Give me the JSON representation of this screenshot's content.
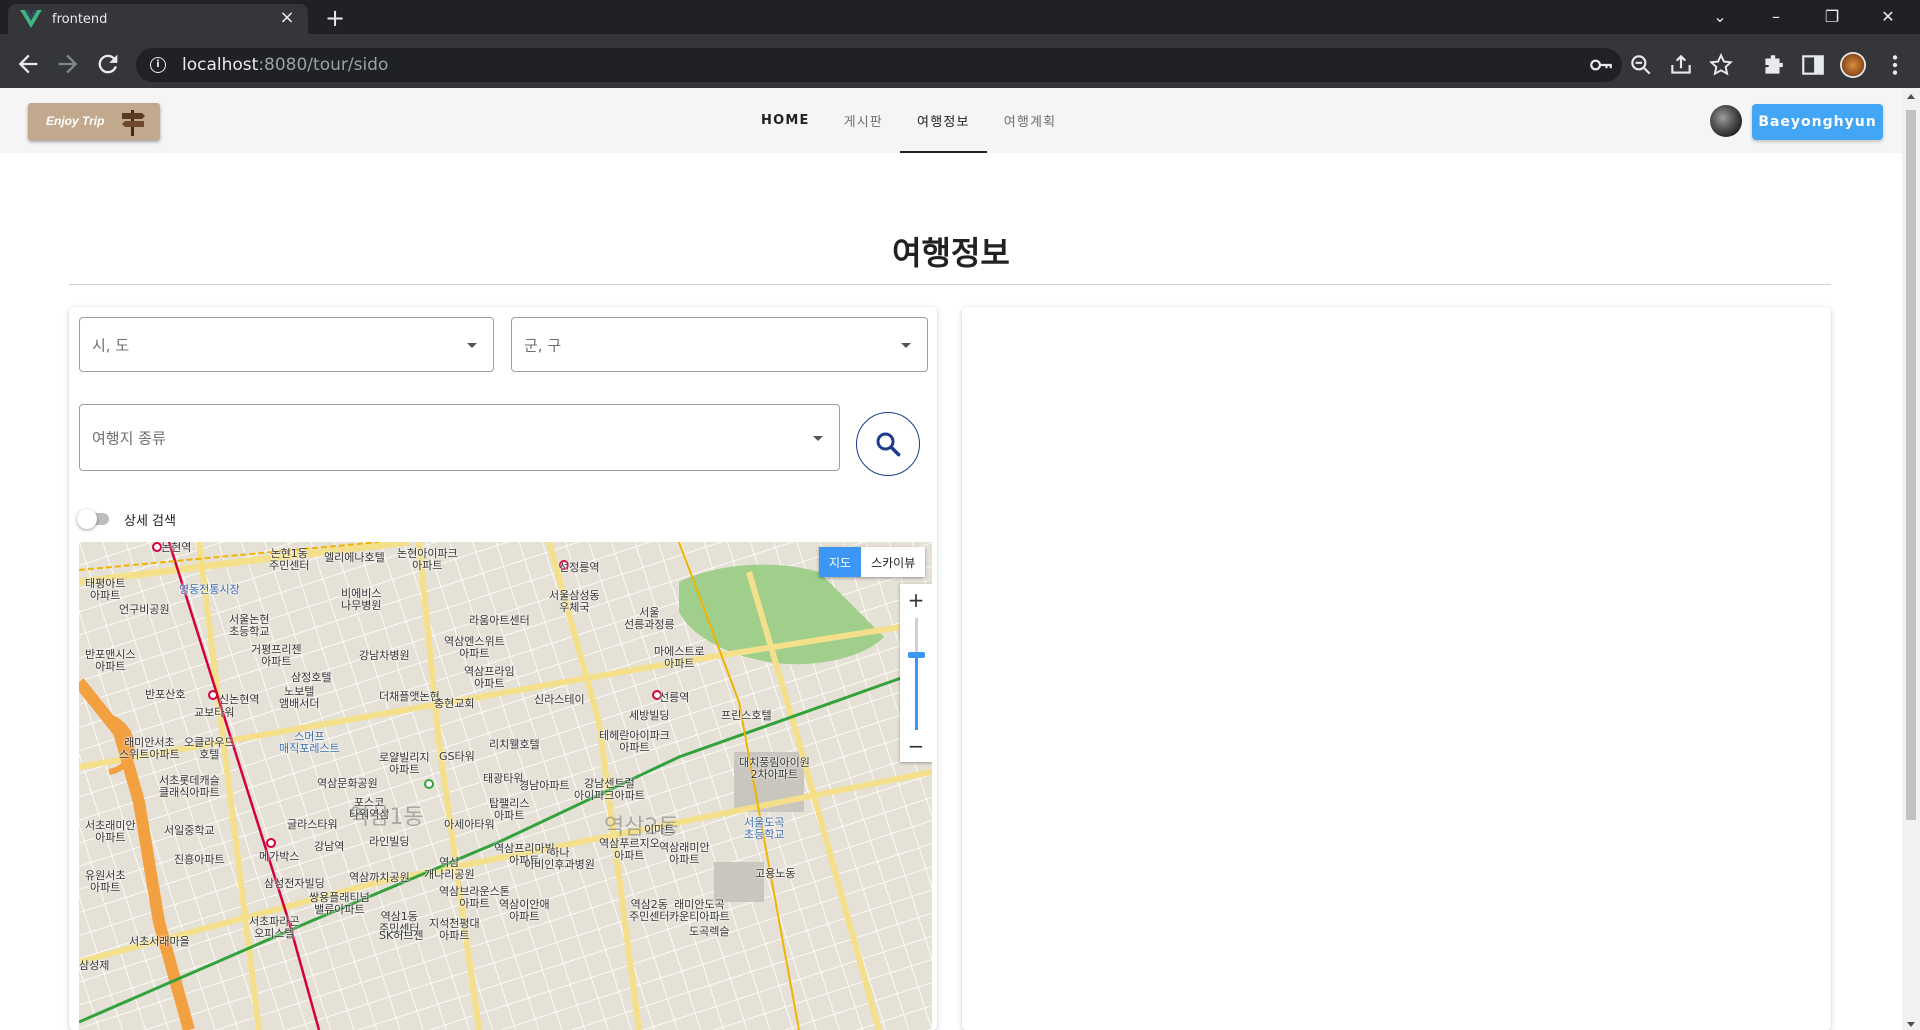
{
  "browser": {
    "tab_title": "frontend",
    "url_host": "localhost",
    "url_path": ":8080/tour/sido"
  },
  "header": {
    "logo_text": "Enjoy Trip",
    "nav": [
      "HOME",
      "게시판",
      "여행정보",
      "여행계획"
    ],
    "active_nav": "여행정보",
    "user_button": "Baeyonghyun"
  },
  "page": {
    "title": "여행정보"
  },
  "filters": {
    "sido_placeholder": "시, 도",
    "gugun_placeholder": "군, 구",
    "type_placeholder": "여행지 종류",
    "detail_toggle_label": "상세 검색",
    "detail_toggle_on": false
  },
  "map": {
    "type_buttons": [
      "지도",
      "스카이뷰"
    ],
    "selected_type": "지도",
    "zoom_in": "+",
    "zoom_out": "−",
    "labels": [
      {
        "text": "논현역",
        "cls": ""
      },
      {
        "text": "논현1동\n주민센터",
        "cls": ""
      },
      {
        "text": "엘리에나호텔",
        "cls": ""
      },
      {
        "text": "논현아이파크\n아파트",
        "cls": ""
      },
      {
        "text": "선정릉역",
        "cls": ""
      },
      {
        "text": "태평아트\n아파트",
        "cls": ""
      },
      {
        "text": "영동전통시장",
        "cls": "blue"
      },
      {
        "text": "비에비스\n나무병원",
        "cls": ""
      },
      {
        "text": "서울삼성동\n우체국",
        "cls": ""
      },
      {
        "text": "서울\n선릉과정릉",
        "cls": ""
      },
      {
        "text": "언구비공원",
        "cls": ""
      },
      {
        "text": "서울논현\n초등학교",
        "cls": ""
      },
      {
        "text": "라움아트센터",
        "cls": ""
      },
      {
        "text": "거평프리젠\n아파트",
        "cls": ""
      },
      {
        "text": "강남차병원",
        "cls": ""
      },
      {
        "text": "역삼엔스위트\n아파트",
        "cls": ""
      },
      {
        "text": "마에스트로\n아파트",
        "cls": ""
      },
      {
        "text": "반포맨시스\n아파트",
        "cls": ""
      },
      {
        "text": "삼정호텔",
        "cls": ""
      },
      {
        "text": "역삼프라임\n아파트",
        "cls": ""
      },
      {
        "text": "반포산호",
        "cls": ""
      },
      {
        "text": "신논현역",
        "cls": ""
      },
      {
        "text": "노보텔\n앰배서더",
        "cls": ""
      },
      {
        "text": "더채플앳논현",
        "cls": ""
      },
      {
        "text": "충현교회",
        "cls": ""
      },
      {
        "text": "신라스테이",
        "cls": ""
      },
      {
        "text": "선릉역",
        "cls": ""
      },
      {
        "text": "교보타워",
        "cls": ""
      },
      {
        "text": "세방빌딩",
        "cls": ""
      },
      {
        "text": "프린스호텔",
        "cls": ""
      },
      {
        "text": "래미안서초\n스위트아파트",
        "cls": ""
      },
      {
        "text": "오클라우드\n호텔",
        "cls": ""
      },
      {
        "text": "스머프\n매직포레스트",
        "cls": "blue"
      },
      {
        "text": "테헤란아이파크\n아파트",
        "cls": ""
      },
      {
        "text": "리치웰호텔",
        "cls": ""
      },
      {
        "text": "로얄빌리지\n아파트",
        "cls": ""
      },
      {
        "text": "GS타워",
        "cls": ""
      },
      {
        "text": "대치풍림아이원\n2차아파트",
        "cls": ""
      },
      {
        "text": "서초롯데캐슬\n클래식아파트",
        "cls": ""
      },
      {
        "text": "역삼문화공원",
        "cls": ""
      },
      {
        "text": "태광타워",
        "cls": ""
      },
      {
        "text": "경남아파트",
        "cls": ""
      },
      {
        "text": "강남센트럴\n아이파크아파트",
        "cls": ""
      },
      {
        "text": "포스코\n타워역삼",
        "cls": ""
      },
      {
        "text": "탑팰리스\n아파트",
        "cls": ""
      },
      {
        "text": "역삼1동",
        "cls": "big"
      },
      {
        "text": "역삼2동",
        "cls": "big"
      },
      {
        "text": "서초래미안\n아파트",
        "cls": ""
      },
      {
        "text": "서일중학교",
        "cls": ""
      },
      {
        "text": "글라스타워",
        "cls": ""
      },
      {
        "text": "아세아타워",
        "cls": ""
      },
      {
        "text": "이마트",
        "cls": ""
      },
      {
        "text": "서울도곡\n초등학교",
        "cls": "blue"
      },
      {
        "text": "라인빌딩",
        "cls": ""
      },
      {
        "text": "역삼푸르지오\n아파트",
        "cls": ""
      },
      {
        "text": "역삼래미안\n아파트",
        "cls": ""
      },
      {
        "text": "메가박스",
        "cls": ""
      },
      {
        "text": "강남역",
        "cls": ""
      },
      {
        "text": "진흥아파트",
        "cls": ""
      },
      {
        "text": "역삼\n개나리공원",
        "cls": ""
      },
      {
        "text": "역삼프리마빌\n아파트",
        "cls": ""
      },
      {
        "text": "하나\n이비인후과병원",
        "cls": ""
      },
      {
        "text": "유원서초\n아파트",
        "cls": ""
      },
      {
        "text": "삼성전자빌딩",
        "cls": ""
      },
      {
        "text": "역삼까치공원",
        "cls": ""
      },
      {
        "text": "고용노동",
        "cls": ""
      },
      {
        "text": "역삼브라운스톤\n아파트",
        "cls": ""
      },
      {
        "text": "쌍용플래티넘\n밸류아파트",
        "cls": ""
      },
      {
        "text": "역삼이안애\n아파트",
        "cls": ""
      },
      {
        "text": "역삼2동\n주민센터",
        "cls": ""
      },
      {
        "text": "래미안도곡\n카운티아파트",
        "cls": ""
      },
      {
        "text": "서초파라곤\n오피스텔",
        "cls": ""
      },
      {
        "text": "역삼1동\n주민센터",
        "cls": ""
      },
      {
        "text": "지석천평대\n아파트",
        "cls": ""
      },
      {
        "text": "도곡렉슬",
        "cls": ""
      },
      {
        "text": "SK허브젠",
        "cls": ""
      },
      {
        "text": "서초서래마을",
        "cls": ""
      },
      {
        "text": "삼성제",
        "cls": ""
      }
    ]
  },
  "colors": {
    "primary_button": "#42a5f5",
    "search_ring": "#1e3c8c",
    "map_active": "#3b96f5",
    "line2": "#33a23d",
    "sinbundang": "#d4003b",
    "highway": "#f3a040"
  }
}
